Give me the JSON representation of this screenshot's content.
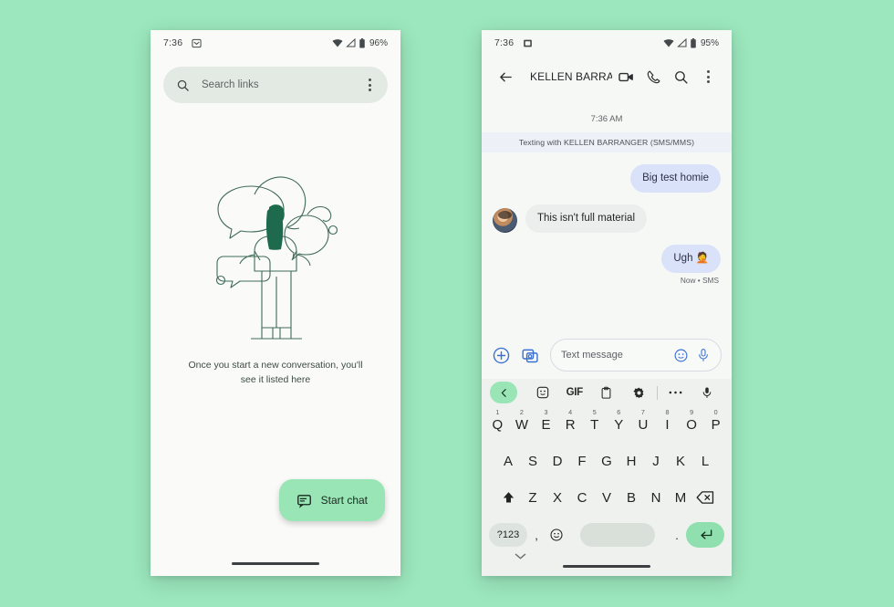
{
  "background_color": "#9ce7bd",
  "left_phone": {
    "status_bar": {
      "time": "7:36",
      "app_icon": "messages-icon",
      "wifi_icon": "wifi-icon",
      "signal_icon": "signal-icon",
      "battery_icon": "battery-icon",
      "battery_percent": "96%"
    },
    "search": {
      "placeholder": "Search links",
      "search_icon": "search-icon",
      "overflow_icon": "overflow-menu-icon"
    },
    "empty_state": {
      "illustration": "people-chatting-illustration",
      "message": "Once you start a new conversation, you'll see it listed here"
    },
    "fab": {
      "label": "Start chat",
      "icon": "chat-bubble-icon",
      "color": "#9ae5b6"
    },
    "nav_bar": "gesture-nav-bar"
  },
  "right_phone": {
    "status_bar": {
      "time": "7:36",
      "app_icon": "screenshot-icon",
      "wifi_icon": "wifi-icon",
      "signal_icon": "signal-icon",
      "battery_icon": "battery-icon",
      "battery_percent": "95%"
    },
    "header": {
      "back_icon": "back-arrow-icon",
      "title": "KELLEN BARRANG…",
      "video_icon": "video-call-icon",
      "call_icon": "phone-call-icon",
      "search_icon": "search-icon",
      "overflow_icon": "overflow-menu-icon"
    },
    "thread": {
      "day_stamp": "7:36 AM",
      "system_hint": "Texting with KELLEN BARRANGER (SMS/MMS)",
      "messages": [
        {
          "text": "Big test homie",
          "direction": "out",
          "bubble_color": "#dae2f9"
        },
        {
          "text": "This isn't full material",
          "direction": "in",
          "bubble_color": "#eceeed",
          "avatar": "contact-avatar"
        },
        {
          "text": "Ugh 🤦",
          "direction": "out",
          "bubble_color": "#dae2f9",
          "status": "Now • SMS"
        }
      ]
    },
    "compose": {
      "plus_icon": "add-attachment-icon",
      "gallery_icon": "gallery-icon",
      "placeholder": "Text message",
      "emoji_icon": "emoji-icon",
      "mic_icon": "microphone-icon",
      "accent_color": "#3b6fd4"
    },
    "keyboard": {
      "toolbar": [
        "chevron-left-icon",
        "sticker-icon",
        "gif-label",
        "clipboard-icon",
        "settings-gear-icon",
        "more-icon",
        "microphone-icon"
      ],
      "gif_label": "GIF",
      "row1": [
        {
          "letter": "Q",
          "num": "1"
        },
        {
          "letter": "W",
          "num": "2"
        },
        {
          "letter": "E",
          "num": "3"
        },
        {
          "letter": "R",
          "num": "4"
        },
        {
          "letter": "T",
          "num": "5"
        },
        {
          "letter": "Y",
          "num": "6"
        },
        {
          "letter": "U",
          "num": "7"
        },
        {
          "letter": "I",
          "num": "8"
        },
        {
          "letter": "O",
          "num": "9"
        },
        {
          "letter": "P",
          "num": "0"
        }
      ],
      "row2": [
        "A",
        "S",
        "D",
        "F",
        "G",
        "H",
        "J",
        "K",
        "L"
      ],
      "row3": [
        "Z",
        "X",
        "C",
        "V",
        "B",
        "N",
        "M"
      ],
      "shift_icon": "shift-icon",
      "backspace_icon": "backspace-icon",
      "symbols_key": "?123",
      "comma_key": ",",
      "period_key": ".",
      "emoji_key_icon": "emoji-icon",
      "space_key": "",
      "enter_icon": "enter-icon",
      "enter_color": "#8fe0ae",
      "dismiss_icon": "chevron-down-icon"
    },
    "nav_bar": "gesture-nav-bar"
  }
}
